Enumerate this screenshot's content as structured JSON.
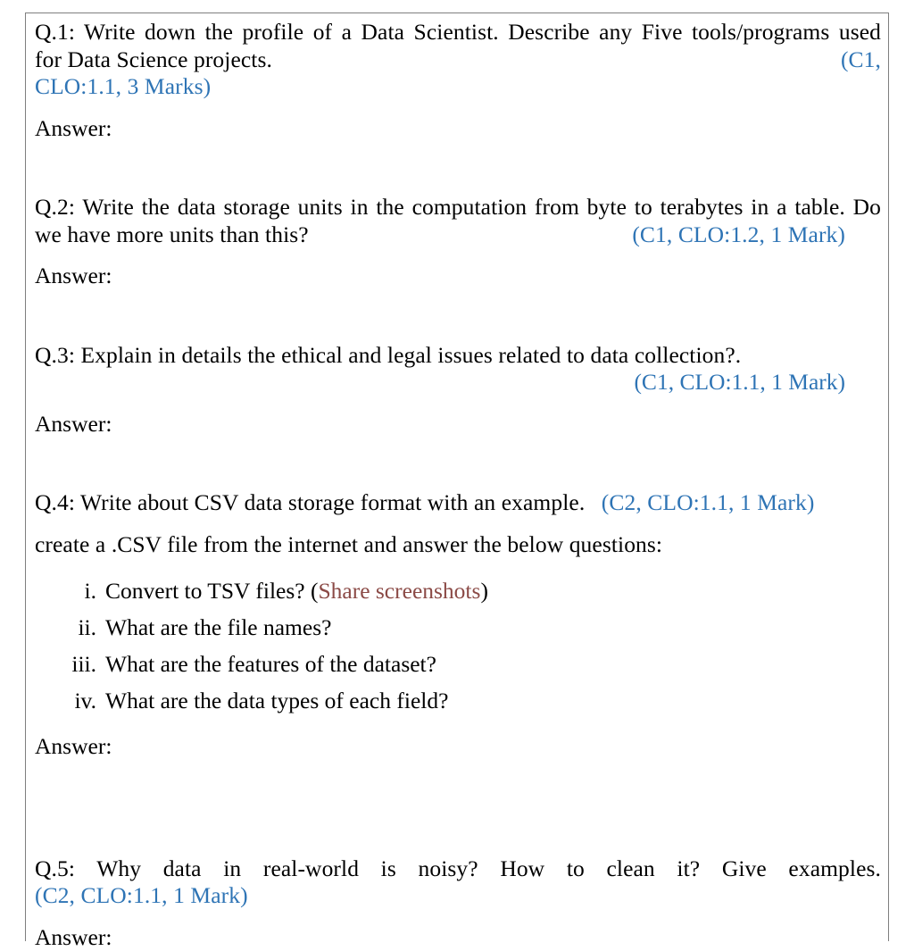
{
  "document": {
    "kind": "exam-question-sheet",
    "accent_color_marks": "#2e74b5",
    "accent_color_note": "#8b4a46",
    "border_color": "#7f7f7f",
    "answer_label": "Answer:"
  },
  "questions": [
    {
      "id": "q1",
      "number": "Q.1:",
      "text": "Q.1: Write down the profile of a Data Scientist. Describe any Five tools/programs used for Data Science projects.",
      "body_line_1": "Q.1: Write down the profile of a Data Scientist. Describe any Five tools/programs used",
      "body_line_2": "for Data Science projects.",
      "mark_inline": "(C1,",
      "mark_wrapped": "CLO:1.1, 3 Marks)",
      "marks_full": "(C1, CLO:1.1, 3 Marks)",
      "answer_label": "Answer:"
    },
    {
      "id": "q2",
      "number": "Q.2:",
      "body_line_1": "Q.2: Write the data storage units in the computation from byte to terabytes in a table. Do",
      "body_line_2": "we have more units than this?",
      "marks_full": "(C1, CLO:1.2, 1 Mark)",
      "answer_label": "Answer:"
    },
    {
      "id": "q3",
      "number": "Q.3:",
      "body_line_1": "Q.3: Explain in details the ethical and legal issues related to data collection?.",
      "marks_full": "(C1, CLO:1.1, 1 Mark)",
      "answer_label": "Answer:"
    },
    {
      "id": "q4",
      "number": "Q.4:",
      "body_line_1": "Q.4: Write about CSV data storage format with an example.",
      "marks_full": "(C2, CLO:1.1, 1 Mark)",
      "body_line_2": "create a .CSV file from the internet and answer the below questions:",
      "sub_items": [
        {
          "marker": "i.",
          "text": "Convert to TSV files? (",
          "note": "Share screenshots",
          "tail": ")"
        },
        {
          "marker": "ii.",
          "text": "What are the file names?",
          "note": "",
          "tail": ""
        },
        {
          "marker": "iii.",
          "text": "What are the features of the dataset?",
          "note": "",
          "tail": ""
        },
        {
          "marker": "iv.",
          "text": "What are the data types of each field?",
          "note": "",
          "tail": ""
        }
      ],
      "answer_label": "Answer:"
    },
    {
      "id": "q5",
      "number": "Q.5:",
      "body_line_1": "Q.5: Why data in real-world is noisy? How to clean it? Give  examples.",
      "marks_full": "(C2, CLO:1.1, 1 Mark)",
      "answer_label": "Answer:"
    }
  ]
}
